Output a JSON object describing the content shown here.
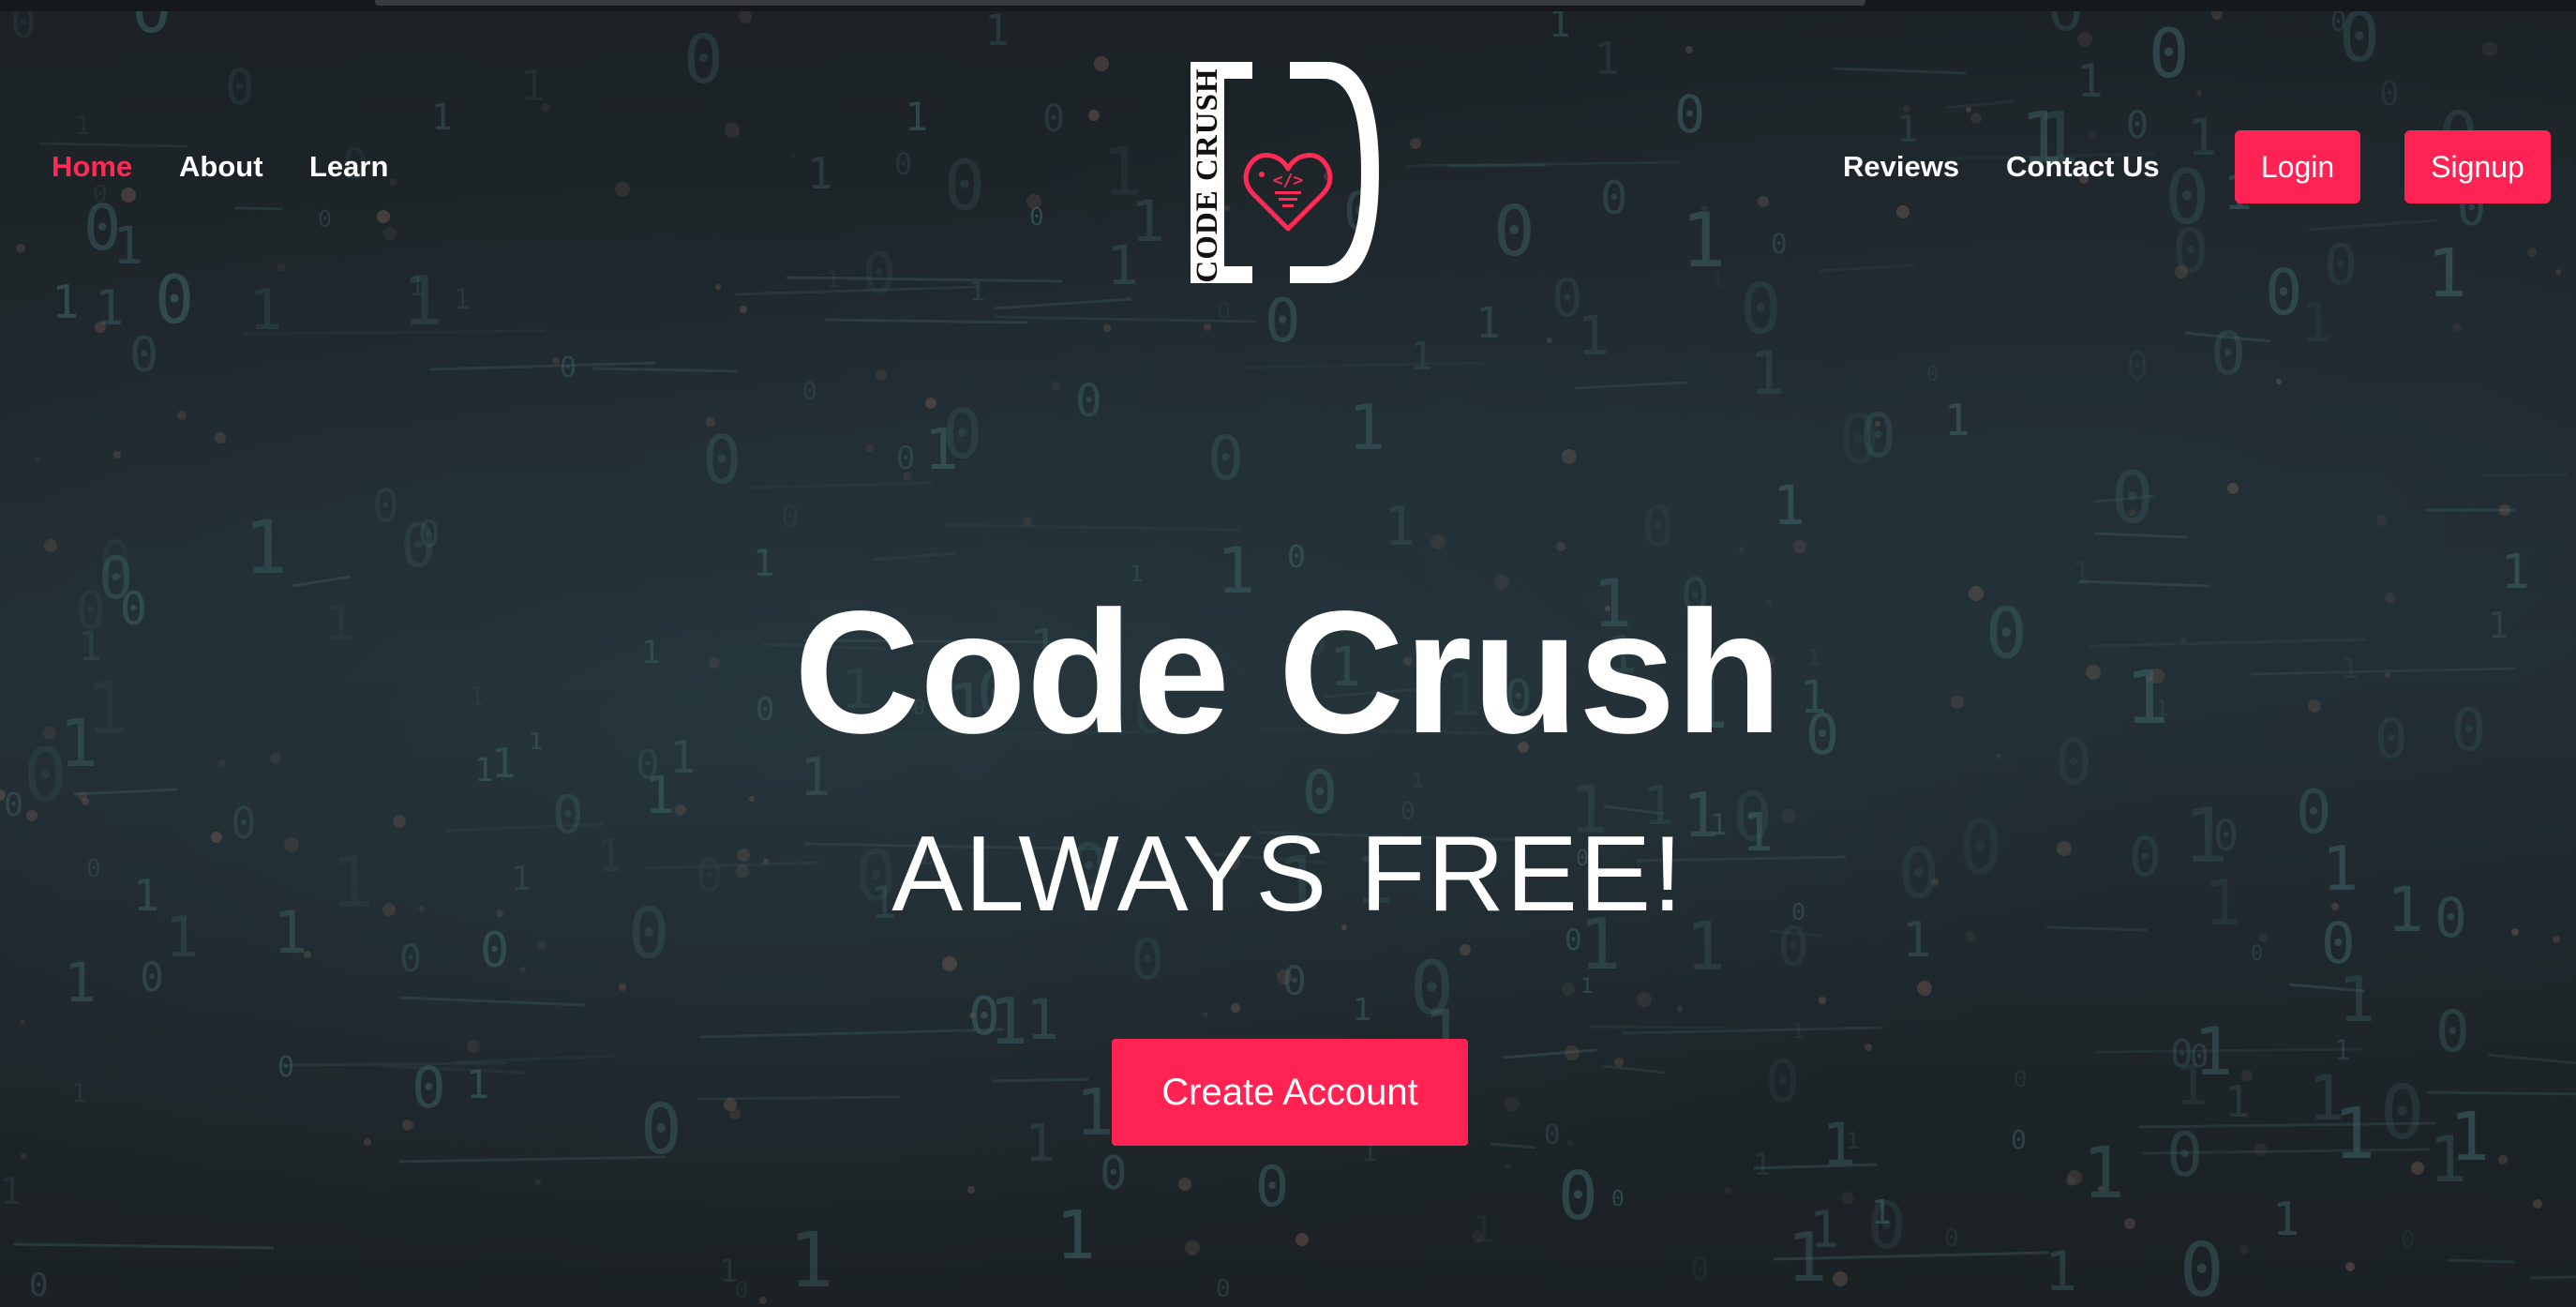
{
  "nav": {
    "left_links": [
      "Home",
      "About",
      "Learn"
    ],
    "right_links": [
      "Reviews",
      "Contact Us"
    ],
    "login_label": "Login",
    "signup_label": "Signup",
    "active": "Home"
  },
  "logo": {
    "wordmark": "CODE CRUSH",
    "icon": "heart-code-icon"
  },
  "hero": {
    "title": "Code Crush",
    "subtitle": "ALWAYS FREE!",
    "cta_label": "Create Account",
    "background": "binary-code-matrix"
  },
  "colors": {
    "accent": "#ff2353",
    "active_link": "#ff2a55",
    "background": "#1d2326",
    "text": "#ffffff"
  }
}
